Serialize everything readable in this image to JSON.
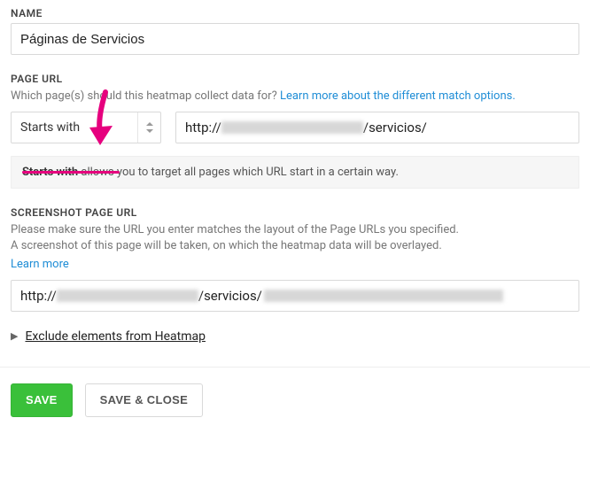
{
  "name": {
    "label": "NAME",
    "value": "Páginas de Servicios"
  },
  "pageUrl": {
    "label": "PAGE URL",
    "help_prefix": "Which page(s) should this heatmap collect data for? ",
    "help_link": "Learn more about the different match options.",
    "select_value": "Starts with",
    "url_prefix": "http://",
    "url_segment": "/servicios/",
    "explain_bold": "Starts with",
    "explain_rest": " allows you to target all pages which URL start in a certain way."
  },
  "screenshotUrl": {
    "label": "SCREENSHOT PAGE URL",
    "help_line1": "Please make sure the URL you enter matches the layout of the Page URLs you specified.",
    "help_line2": "A screenshot of this page will be taken, on which the heatmap data will be overlayed.",
    "learn_more": "Learn more",
    "url_prefix": "http://",
    "url_segment": "/servicios/"
  },
  "expander": {
    "label": "Exclude elements from Heatmap"
  },
  "actions": {
    "save": "SAVE",
    "saveClose": "SAVE & CLOSE"
  }
}
